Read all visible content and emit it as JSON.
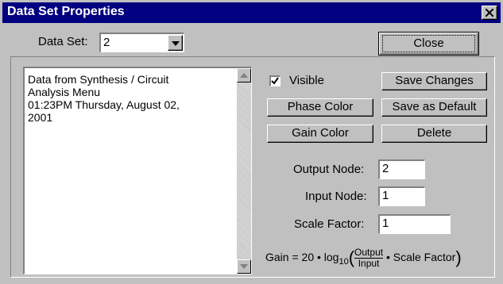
{
  "window": {
    "title": "Data Set Properties"
  },
  "dataset": {
    "label": "Data Set:",
    "value": "2"
  },
  "buttons": {
    "close": "Close",
    "save_changes": "Save Changes",
    "phase_color": "Phase Color",
    "save_default": "Save as Default",
    "gain_color": "Gain Color",
    "delete": "Delete"
  },
  "visible": {
    "label": "Visible",
    "checked": true
  },
  "description_lines": [
    "Data from Synthesis / Circuit",
    "Analysis Menu",
    "01:23PM Thursday, August 02,",
    "2001"
  ],
  "fields": {
    "output_node": {
      "label": "Output Node:",
      "value": "2"
    },
    "input_node": {
      "label": "Input Node:",
      "value": "1"
    },
    "scale_factor": {
      "label": "Scale Factor:",
      "value": "1"
    }
  },
  "formula": {
    "prefix": "Gain = 20 • log",
    "sub": "10",
    "numerator": "Output",
    "denominator": "Input",
    "suffix": "• Scale Factor"
  }
}
